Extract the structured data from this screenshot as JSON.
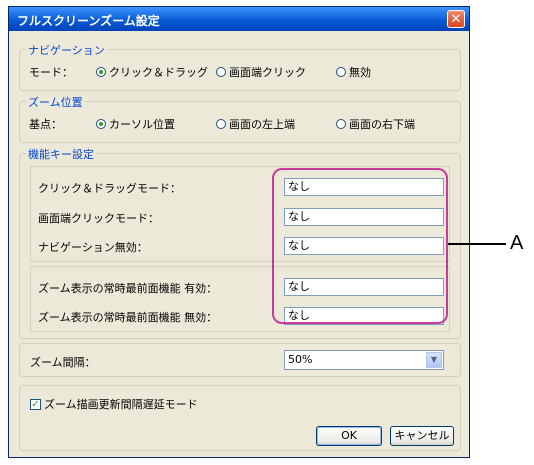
{
  "window": {
    "title": "フルスクリーンズーム設定",
    "close_glyph": "✕"
  },
  "navigation": {
    "legend": "ナビゲーション",
    "mode_label": "モード：",
    "options": [
      {
        "label": "クリック＆ドラッグ",
        "selected": true
      },
      {
        "label": "画面端クリック",
        "selected": false
      },
      {
        "label": "無効",
        "selected": false
      }
    ]
  },
  "zoom_position": {
    "legend": "ズーム位置",
    "base_label": "基点：",
    "options": [
      {
        "label": "カーソル位置",
        "selected": true
      },
      {
        "label": "画面の左上端",
        "selected": false
      },
      {
        "label": "画面の右下端",
        "selected": false
      }
    ]
  },
  "function_keys": {
    "legend": "機能キー設定",
    "rows": [
      {
        "label": "クリック＆ドラッグモード：",
        "value": "なし"
      },
      {
        "label": "画面端クリックモード：",
        "value": "なし"
      },
      {
        "label": "ナビゲーション無効：",
        "value": "なし"
      },
      {
        "label": "ズーム表示の常時最前面機能 有効：",
        "value": "なし"
      },
      {
        "label": "ズーム表示の常時最前面機能 無効：",
        "value": "なし"
      }
    ]
  },
  "zoom_interval": {
    "label": "ズーム間隔：",
    "value": "50%"
  },
  "delay_mode": {
    "label": "ズーム描画更新間隔遅延モード",
    "checked": true
  },
  "buttons": {
    "ok": "OK",
    "cancel": "キャンセル"
  },
  "callout": {
    "letter": "A"
  },
  "colors": {
    "accent": "#0046d5",
    "highlight": "#c83a9c",
    "titlebar": "#0a5bd6"
  }
}
